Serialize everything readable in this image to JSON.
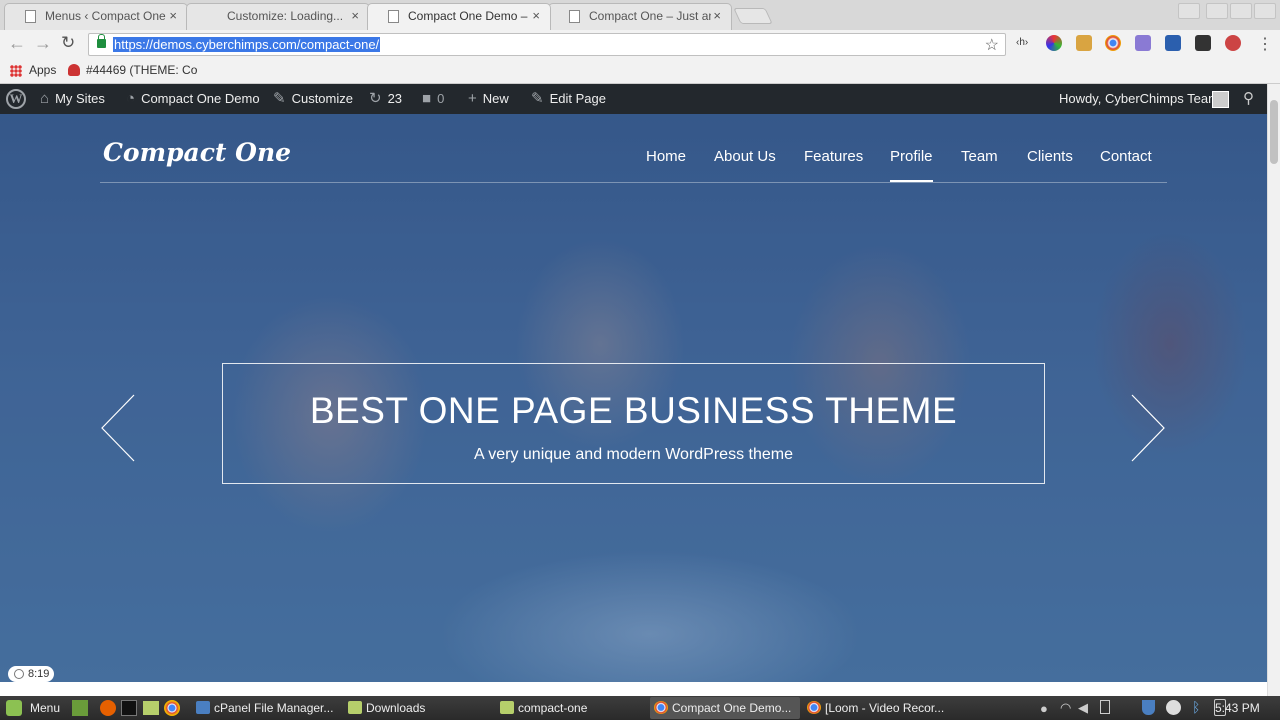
{
  "browser": {
    "tabs": [
      {
        "label": "Menus ‹ Compact One",
        "active": false
      },
      {
        "label": "Customize: Loading...",
        "active": false
      },
      {
        "label": "Compact One Demo – C",
        "active": true
      },
      {
        "label": "Compact One – Just an",
        "active": false
      }
    ],
    "close_glyph": "×",
    "url": "https://demos.cyberchimps.com/compact-one/",
    "bookmarks": [
      {
        "label": "Apps"
      },
      {
        "label": "#44469 (THEME: Co"
      }
    ]
  },
  "adminbar": {
    "my_sites": "My Sites",
    "site_name": "Compact One Demo",
    "customize": "Customize",
    "updates_count": "23",
    "comments_count": "0",
    "new_label": "New",
    "edit_page": "Edit Page",
    "howdy": "Howdy, CyberChimps Team"
  },
  "site": {
    "logo": "Compact One",
    "nav": [
      "Home",
      "About Us",
      "Features",
      "Profile",
      "Team",
      "Clients",
      "Contact"
    ],
    "active_nav": "Profile",
    "hero_title": "BEST ONE PAGE BUSINESS THEME",
    "hero_subtitle": "A very unique and modern WordPress theme",
    "timer": "8:19"
  },
  "taskbar": {
    "menu_label": "Menu",
    "windows": [
      {
        "label": "cPanel File Manager...",
        "icon": "window-icon",
        "active": false
      },
      {
        "label": "Downloads",
        "icon": "folder-icon",
        "active": false
      },
      {
        "label": "compact-one",
        "icon": "folder-icon",
        "active": false
      },
      {
        "label": "Compact One Demo...",
        "icon": "chrome-icon",
        "active": true
      },
      {
        "label": "[Loom - Video Recor...",
        "icon": "chrome-icon",
        "active": false
      }
    ],
    "clock": "5:43 PM"
  },
  "colors": {
    "adminbar_bg": "#23282d",
    "url_highlight": "#3b78e7",
    "hero_overlay": "#3a5c8c"
  }
}
